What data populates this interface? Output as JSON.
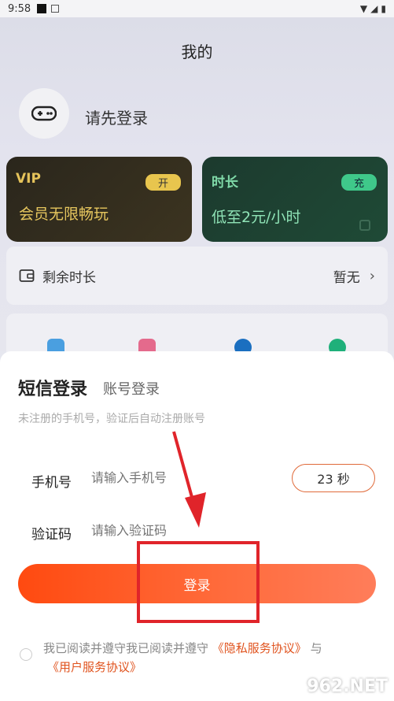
{
  "status_bar": {
    "time": "9:58"
  },
  "header": {
    "title": "我的"
  },
  "profile": {
    "login_prompt": "请先登录"
  },
  "vip_card": {
    "title": "VIP",
    "badge": "开",
    "description": "会员无限畅玩"
  },
  "time_card": {
    "title": "时长",
    "badge": "充",
    "description": "低至2元/小时"
  },
  "remaining": {
    "label": "剩余时长",
    "value": "暂无"
  },
  "login_sheet": {
    "tab_sms": "短信登录",
    "tab_account": "账号登录",
    "hint": "未注册的手机号，验证后自动注册账号",
    "phone_label": "手机号",
    "phone_placeholder": "请输入手机号",
    "code_label": "验证码",
    "code_placeholder": "请输入验证码",
    "countdown": "23 秒",
    "login_button": "登录",
    "agreement_prefix": "我已阅读并遵守我已阅读并遵守",
    "privacy_link": "《隐私服务协议》",
    "agreement_and": "与",
    "user_link": "《用户服务协议》"
  },
  "watermark": "962.NET",
  "colors": {
    "accent": "#ff5a1f",
    "annotation": "#e0242a"
  }
}
